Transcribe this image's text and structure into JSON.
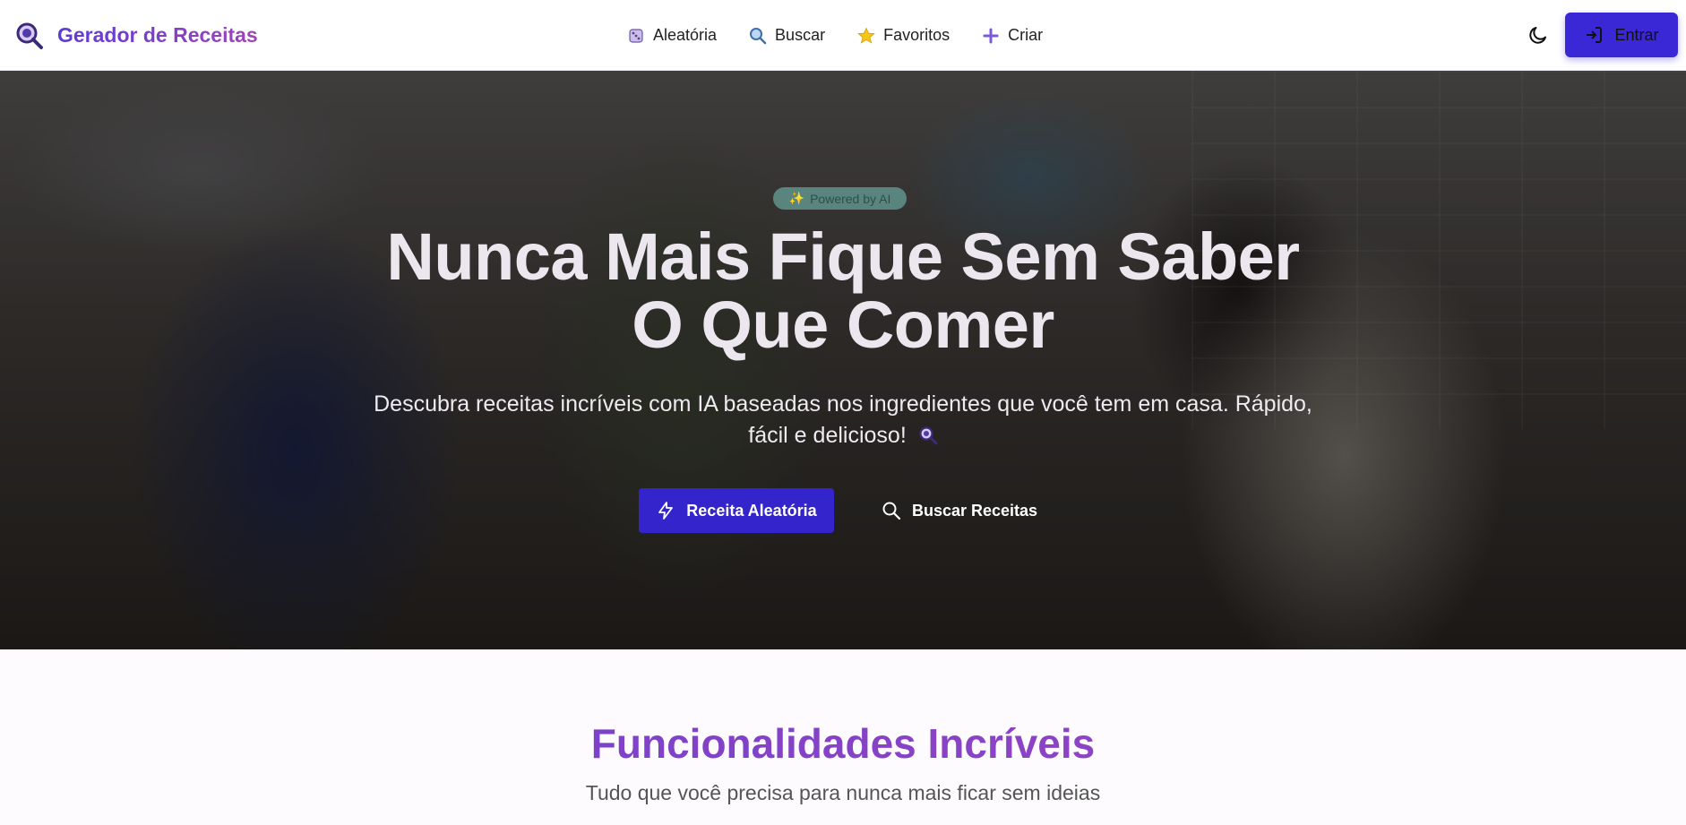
{
  "header": {
    "brand": "Gerador de Receitas",
    "nav": [
      {
        "label": "Aleatória",
        "icon": "dice-icon"
      },
      {
        "label": "Buscar",
        "icon": "magnifier-icon"
      },
      {
        "label": "Favoritos",
        "icon": "star-icon"
      },
      {
        "label": "Criar",
        "icon": "plus-icon"
      }
    ],
    "theme_icon": "moon-icon",
    "login_label": "Entrar"
  },
  "hero": {
    "badge": "Powered by AI",
    "title_line1": "Nunca Mais Fique Sem Saber",
    "title_line2": "O Que Comer",
    "subtitle_line1": "Descubra receitas incríveis com IA baseadas nos ingredientes que você tem em casa. Rápido,",
    "subtitle_line2": "fácil e delicioso!",
    "primary_button": "Receita Aleatória",
    "secondary_button": "Buscar Receitas"
  },
  "features": {
    "title": "Funcionalidades Incríveis",
    "subtitle": "Tudo que você precisa para nunca mais ficar sem ideias"
  },
  "colors": {
    "brand_gradient_start": "#5b3bd6",
    "brand_gradient_end": "#a044b8",
    "primary": "#3424cc",
    "badge_bg": "#78c8be"
  }
}
